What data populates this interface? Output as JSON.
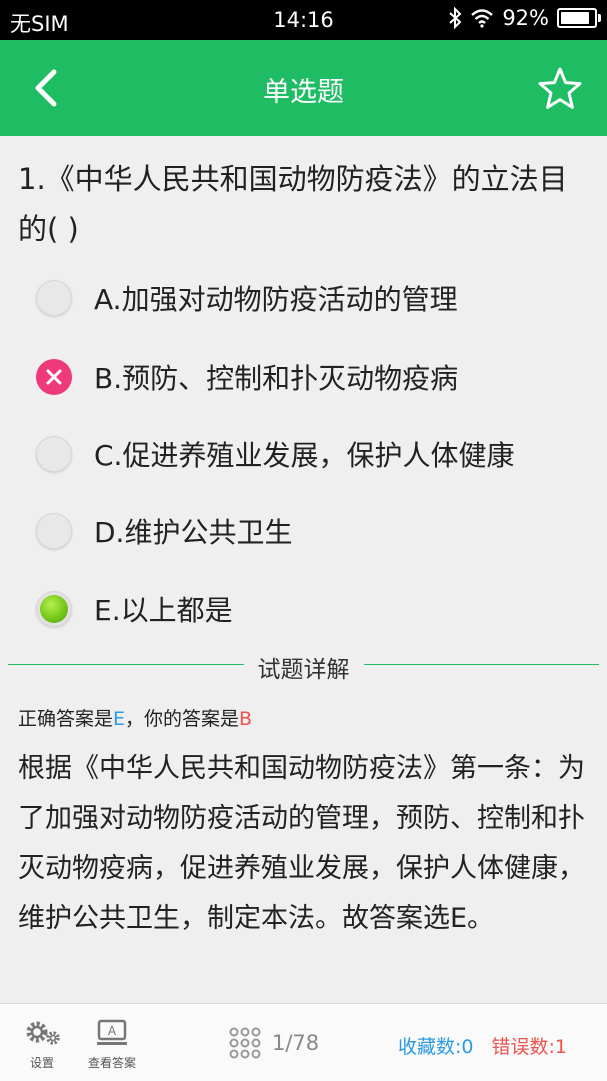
{
  "status_bar": {
    "carrier": "无SIM",
    "time": "14:16",
    "battery": "92%"
  },
  "nav": {
    "title": "单选题"
  },
  "question": {
    "text": "1.《中华人民共和国动物防疫法》的立法目的( )"
  },
  "options": [
    {
      "label": "A.加强对动物防疫活动的管理",
      "state": "none"
    },
    {
      "label": "B.预防、控制和扑灭动物疫病",
      "state": "wrong"
    },
    {
      "label": "C.促进养殖业发展，保护人体健康",
      "state": "none"
    },
    {
      "label": "D.维护公共卫生",
      "state": "none"
    },
    {
      "label": "E.以上都是",
      "state": "correct"
    }
  ],
  "detail": {
    "heading": "试题详解",
    "correct_prefix": "正确答案是",
    "correct_value": "E",
    "your_prefix": "，你的答案是",
    "your_value": "B",
    "explanation": "根据《中华人民共和国动物防疫法》第一条：为了加强对动物防疫活动的管理，预防、控制和扑灭动物疫病，促进养殖业发展，保护人体健康，维护公共卫生，制定本法。故答案选E。"
  },
  "bottom": {
    "settings_label": "设置",
    "view_answer_label": "查看答案",
    "page": "1/78",
    "favorites": "收藏数:0",
    "errors": "错误数:1"
  },
  "colors": {
    "accent": "#1ebc63",
    "blue": "#2b9be6",
    "red": "#f0524e",
    "wrong_mark": "#f0397a"
  },
  "icons": [
    "back-icon",
    "star-icon",
    "wifi-icon",
    "bluetooth-icon",
    "battery-icon",
    "gear-icon",
    "answer-card-icon",
    "grid-icon"
  ]
}
